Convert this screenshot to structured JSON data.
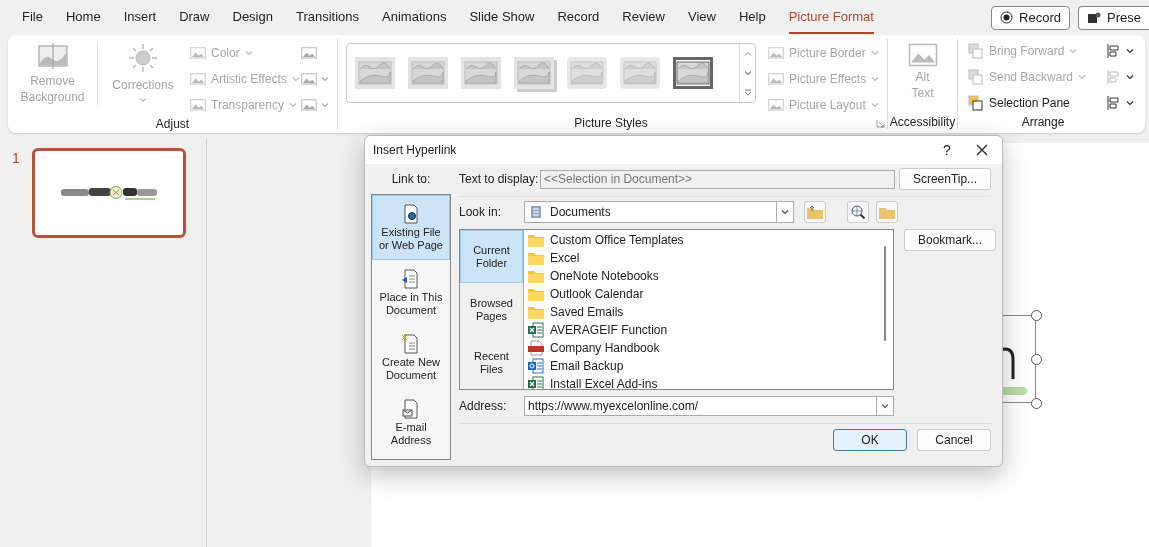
{
  "menu_tabs": [
    {
      "label": "File",
      "selected": false
    },
    {
      "label": "Home",
      "selected": false
    },
    {
      "label": "Insert",
      "selected": false
    },
    {
      "label": "Draw",
      "selected": false
    },
    {
      "label": "Design",
      "selected": false
    },
    {
      "label": "Transitions",
      "selected": false
    },
    {
      "label": "Animations",
      "selected": false
    },
    {
      "label": "Slide Show",
      "selected": false
    },
    {
      "label": "Record",
      "selected": false
    },
    {
      "label": "Review",
      "selected": false
    },
    {
      "label": "View",
      "selected": false
    },
    {
      "label": "Help",
      "selected": false
    },
    {
      "label": "Picture Format",
      "selected": true
    }
  ],
  "top_buttons": [
    {
      "label": "Record",
      "kind": "record"
    },
    {
      "label": "Prese",
      "kind": "present"
    }
  ],
  "ribbon": {
    "adjust": {
      "title": "Adjust",
      "large": [
        {
          "label": "Remove Background",
          "disabled": true
        },
        {
          "label": "Corrections",
          "disabled": true
        }
      ],
      "small": [
        {
          "label": "Color",
          "disabled": true
        },
        {
          "label": "Artistic Effects",
          "disabled": true
        },
        {
          "label": "Transparency",
          "disabled": true
        }
      ]
    },
    "styles": {
      "title": "Picture Styles",
      "thumbnails": [
        {
          "kind": "plain"
        },
        {
          "kind": "plain"
        },
        {
          "kind": "plain"
        },
        {
          "kind": "shadow"
        },
        {
          "kind": "soft"
        },
        {
          "kind": "soft"
        },
        {
          "kind": "frame"
        }
      ],
      "options": [
        {
          "label": "Picture Border",
          "disabled": true
        },
        {
          "label": "Picture Effects",
          "disabled": true
        },
        {
          "label": "Picture Layout",
          "disabled": true
        }
      ]
    },
    "accessibility": {
      "title": "Accessibility",
      "button": {
        "label": "Alt Text",
        "disabled": true
      }
    },
    "arrange": {
      "title": "Arrange",
      "items": [
        {
          "label": "Bring Forward",
          "disabled": true
        },
        {
          "label": "Send Backward",
          "disabled": true
        },
        {
          "label": "Selection Pane",
          "disabled": false
        }
      ]
    }
  },
  "slides": [
    {
      "number": "1",
      "selected": true
    }
  ],
  "dialog": {
    "title": "Insert Hyperlink",
    "help": "?",
    "link_to": {
      "label": "Link to:",
      "items": [
        {
          "label": "Existing File or Web Page",
          "kind": "file",
          "selected": true
        },
        {
          "label": "Place in This Document",
          "kind": "place",
          "selected": false
        },
        {
          "label": "Create New Document",
          "kind": "new",
          "selected": false
        },
        {
          "label": "E-mail Address",
          "kind": "email",
          "selected": false
        }
      ]
    },
    "text_to_display": {
      "label": "Text to display:",
      "value": "<<Selection in Document>>",
      "disabled": true
    },
    "screentip_button": "ScreenTip...",
    "look_in": {
      "label": "Look in:",
      "value": "Documents"
    },
    "browse_tabs": [
      {
        "label": "Current Folder",
        "selected": true
      },
      {
        "label": "Browsed Pages",
        "selected": false
      },
      {
        "label": "Recent Files",
        "selected": false
      }
    ],
    "files": [
      {
        "name": "Custom Office Templates",
        "kind": "folder"
      },
      {
        "name": "Excel",
        "kind": "folder"
      },
      {
        "name": "OneNote Notebooks",
        "kind": "folder"
      },
      {
        "name": "Outlook Calendar",
        "kind": "folder"
      },
      {
        "name": "Saved Emails",
        "kind": "folder"
      },
      {
        "name": "AVERAGEIF Function",
        "kind": "excel"
      },
      {
        "name": "Company Handbook",
        "kind": "pdf"
      },
      {
        "name": "Email Backup",
        "kind": "outlook"
      },
      {
        "name": "Install Excel Add-ins",
        "kind": "excel"
      }
    ],
    "bookmark_button": "Bookmark...",
    "address": {
      "label": "Address:",
      "value": "https://www.myexcelonline.com/"
    },
    "buttons": [
      {
        "label": "OK",
        "kind": "default"
      },
      {
        "label": "Cancel",
        "kind": "normal"
      }
    ]
  }
}
